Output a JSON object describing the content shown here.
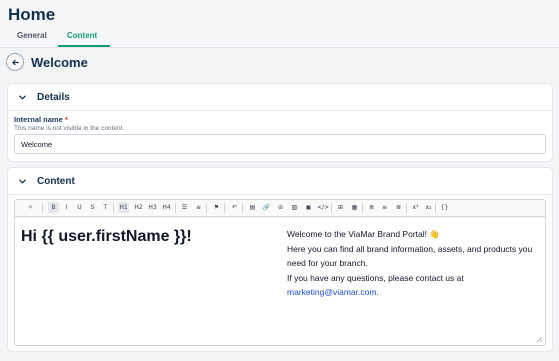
{
  "app": {
    "title": "Home"
  },
  "tabs": [
    {
      "label": "General",
      "active": false
    },
    {
      "label": "Content",
      "active": true
    }
  ],
  "page": {
    "title": "Welcome"
  },
  "details": {
    "title": "Details",
    "field": {
      "label": "Internal name",
      "required_mark": "*",
      "hint": "This name is not visible in the content.",
      "value": "Welcome"
    }
  },
  "content": {
    "title": "Content",
    "toolbar": {
      "buttons": [
        {
          "name": "ai-assist",
          "glyph": "✧"
        },
        {
          "name": "bold",
          "glyph": "B",
          "active": true
        },
        {
          "name": "italic",
          "glyph": "I"
        },
        {
          "name": "underline",
          "glyph": "U"
        },
        {
          "name": "strikethrough",
          "glyph": "S"
        },
        {
          "name": "clear-format",
          "glyph": "T"
        },
        {
          "name": "h1",
          "glyph": "H1",
          "active": true
        },
        {
          "name": "h2",
          "glyph": "H2"
        },
        {
          "name": "h3",
          "glyph": "H3"
        },
        {
          "name": "h4",
          "glyph": "H4"
        },
        {
          "name": "bullet-list",
          "glyph": "☰"
        },
        {
          "name": "ordered-list",
          "glyph": "≡"
        },
        {
          "name": "flag",
          "glyph": "⚑"
        },
        {
          "name": "undo",
          "glyph": "↶"
        },
        {
          "name": "embed",
          "glyph": "▤"
        },
        {
          "name": "link",
          "glyph": "🔗"
        },
        {
          "name": "unlink",
          "glyph": "⊘"
        },
        {
          "name": "image",
          "glyph": "▨"
        },
        {
          "name": "media",
          "glyph": "▣"
        },
        {
          "name": "code",
          "glyph": "</>"
        },
        {
          "name": "grid",
          "glyph": "⊞"
        },
        {
          "name": "table",
          "glyph": "▦"
        },
        {
          "name": "align-left",
          "glyph": "≣"
        },
        {
          "name": "align-center",
          "glyph": "≡"
        },
        {
          "name": "align-right",
          "glyph": "≣"
        },
        {
          "name": "superscript",
          "glyph": "x²"
        },
        {
          "name": "subscript",
          "glyph": "x₂"
        },
        {
          "name": "variable",
          "glyph": "{}"
        }
      ]
    },
    "heading": "Hi {{ user.firstName }}!",
    "body": {
      "line1": "Welcome to the ViaMar Brand Portal! 👋",
      "line2": "Here you can find all brand information, assets, and products you need for your branch.",
      "line3": "If you have any questions, please contact us at",
      "email": "marketing@viamar.com",
      "trail": "."
    }
  },
  "colors": {
    "brand": "#13314f",
    "accent": "#0e9a75",
    "link": "#1d4ed8"
  }
}
